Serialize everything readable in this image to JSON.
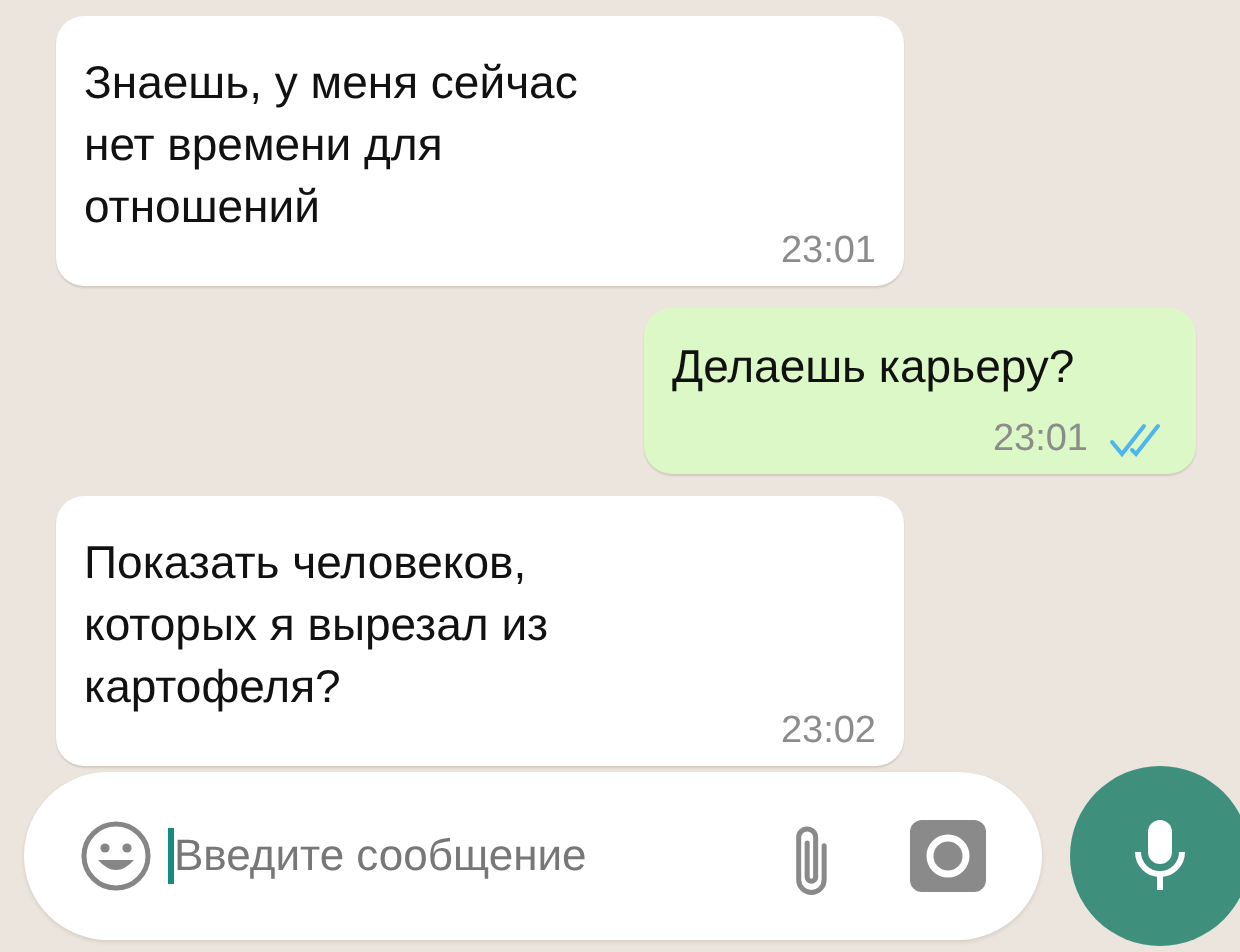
{
  "messages": [
    {
      "kind": "incoming",
      "text": "Знаешь, у меня сейчас\nнет времени для\nотношений",
      "time": "23:01"
    },
    {
      "kind": "outgoing",
      "text": "Делаешь карьеру?",
      "time": "23:01",
      "read": true
    },
    {
      "kind": "incoming",
      "text": "Показать человеков,\nкоторых я вырезал из\nкартофеля?",
      "time": "23:02"
    }
  ],
  "composer": {
    "placeholder": "Введите сообщение"
  }
}
